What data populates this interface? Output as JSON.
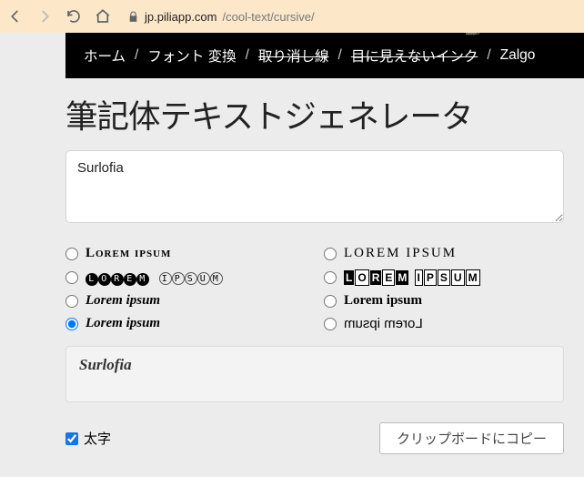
{
  "browser": {
    "url_host": "jp.piliapp.com",
    "url_path": "/cool-text/cursive/"
  },
  "breadcrumb": {
    "home": "ホーム",
    "conv": "フォント 変換",
    "strike": "取り消し線",
    "invisible": "目に見えないインク",
    "zalgo": "Zalgo"
  },
  "page": {
    "title": "筆記体テキストジェネレータ",
    "input_value": "Surlofia",
    "output_value": "Surlofia",
    "bold_label": "太字",
    "copy_label": "クリップボードにコピー"
  },
  "options": {
    "o1": "Lorem ipsum",
    "o2": "LOREM IPSUM",
    "o3a": "LOREM",
    "o3b": "IPSUM",
    "o4a": "LOREM",
    "o4b": "IPSUM",
    "o5": "Lorem ipsum",
    "o6": "Lorem ipsum",
    "o7": "Lorem ipsum",
    "o8": "Lorem ipsum"
  }
}
